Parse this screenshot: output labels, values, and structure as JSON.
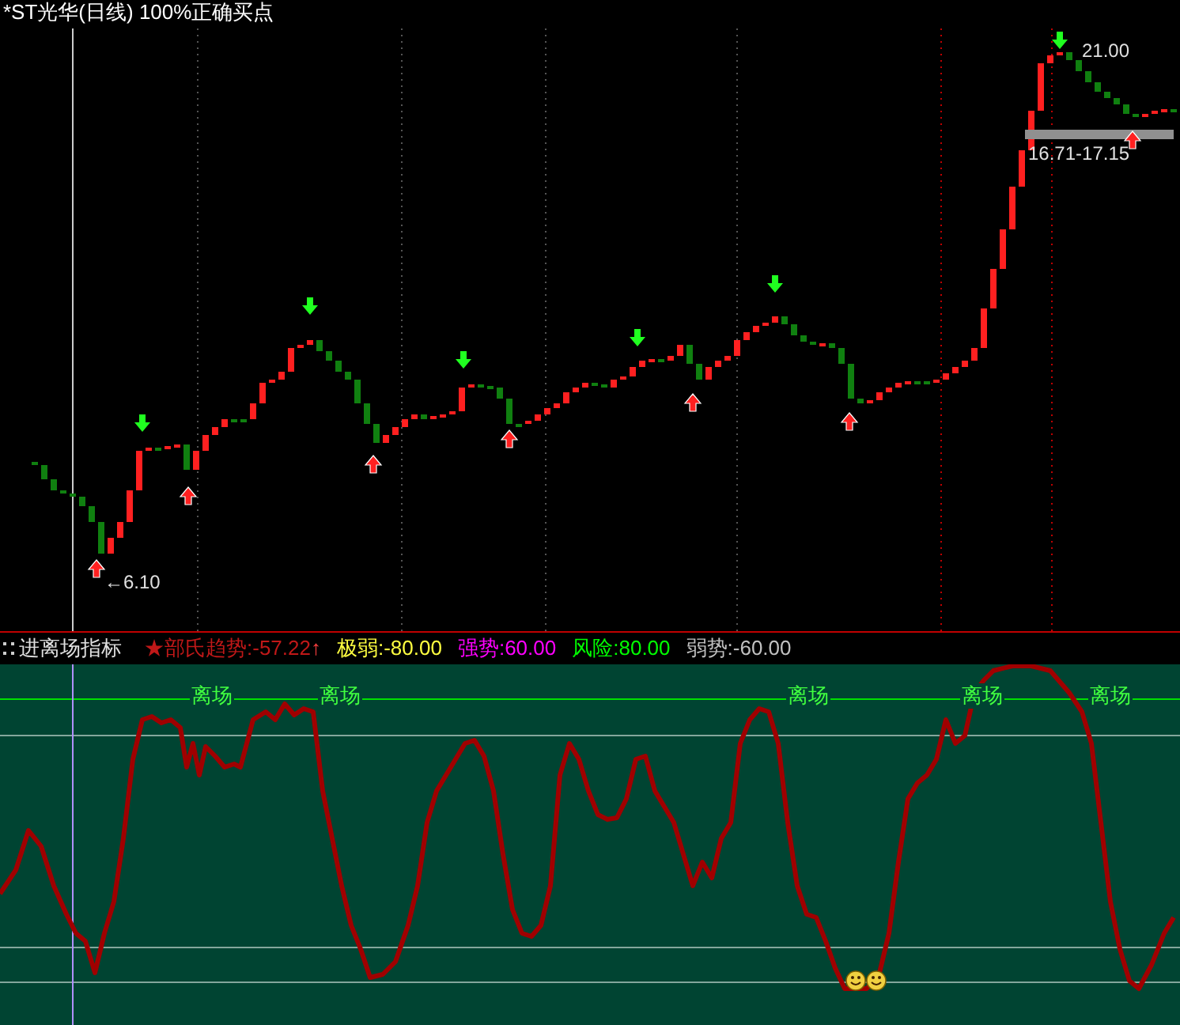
{
  "chart": {
    "title": "*ST光华(日线) 100%正确买点",
    "price_labels": [
      {
        "kind": "low",
        "text": "←6.10"
      },
      {
        "kind": "high",
        "text": "21.00"
      },
      {
        "kind": "range",
        "text": "16.71-17.15"
      }
    ]
  },
  "indicator": {
    "name": "进离场指标",
    "series": [
      {
        "label": "★部氏趋势:-57.22",
        "color": "#c01818",
        "arrow": "↑"
      },
      {
        "label": "极弱:-80.00",
        "color": "#ffff40"
      },
      {
        "label": "强势:60.00",
        "color": "#ff00ff"
      },
      {
        "label": "风险:80.00",
        "color": "#00ff00"
      },
      {
        "label": "弱势:-60.00",
        "color": "#c0c0c0"
      }
    ],
    "exit_labels": [
      "离场",
      "离场",
      "离场",
      "离场",
      "离场"
    ]
  }
}
